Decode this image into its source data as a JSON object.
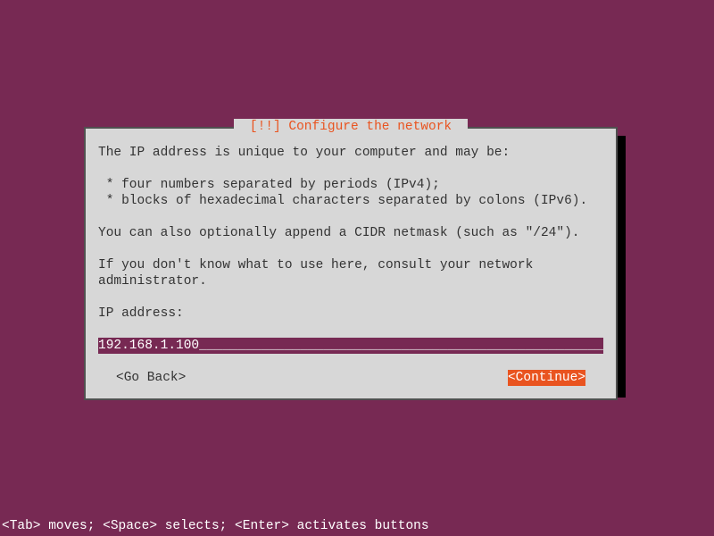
{
  "dialog": {
    "title": " [!!] Configure the network ",
    "description": "The IP address is unique to your computer and may be:\n\n * four numbers separated by periods (IPv4);\n * blocks of hexadecimal characters separated by colons (IPv6).\n\nYou can also optionally append a CIDR netmask (such as \"/24\").\n\nIf you don't know what to use here, consult your network administrator.",
    "field_label": "IP address:",
    "input_value": "192.168.1.100",
    "buttons": {
      "back": "<Go Back>",
      "continue": "<Continue>"
    }
  },
  "footer": "<Tab> moves; <Space> selects; <Enter> activates buttons"
}
